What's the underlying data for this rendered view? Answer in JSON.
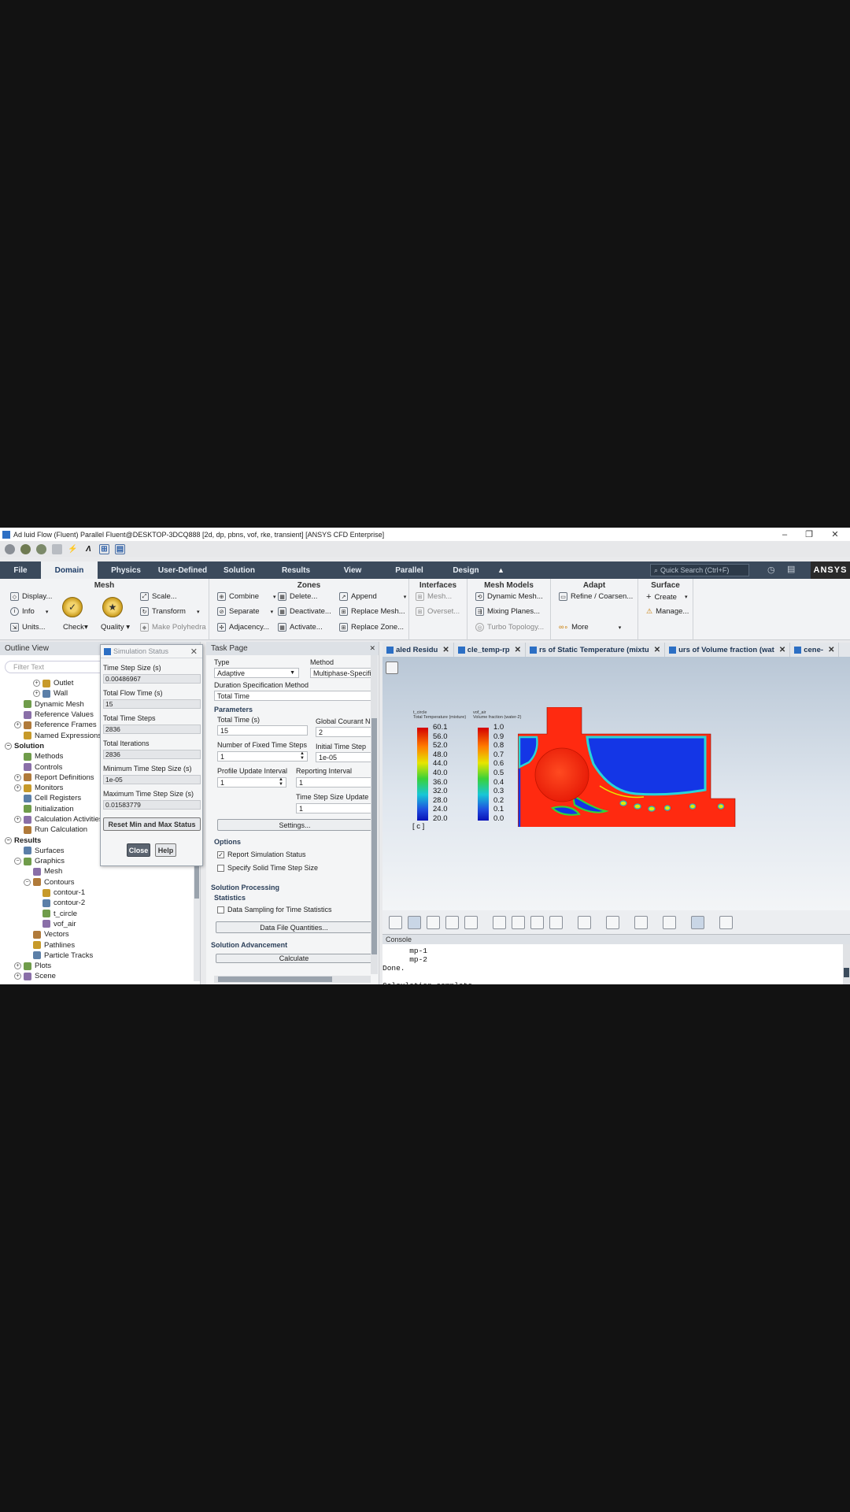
{
  "window": {
    "title": "Ad luid Flow (Fluent) Parallel Fluent@DESKTOP-3DCQ888  [2d, dp, pbns, vof, rke, transient] [ANSYS CFD Enterprise]",
    "minimize": "–",
    "restore": "❐",
    "close": "✕"
  },
  "ribbon_tabs": [
    "File",
    "Domain",
    "Physics",
    "User-Defined",
    "Solution",
    "Results",
    "View",
    "Parallel",
    "Design"
  ],
  "quick_search": {
    "placeholder": "Quick Search (Ctrl+F)"
  },
  "brand": "ANSYS",
  "ribbon": {
    "mesh": {
      "title": "Mesh",
      "display": "Display...",
      "info": "Info",
      "units": "Units...",
      "check": "Check",
      "quality": "Quality",
      "scale": "Scale...",
      "transform": "Transform",
      "polyhedra": "Make Polyhedra"
    },
    "zones": {
      "title": "Zones",
      "combine": "Combine",
      "separate": "Separate",
      "adjacency": "Adjacency...",
      "delete": "Delete...",
      "deactivate": "Deactivate...",
      "activate": "Activate...",
      "append": "Append",
      "replace_mesh": "Replace Mesh...",
      "replace_zone": "Replace Zone..."
    },
    "interfaces": {
      "title": "Interfaces",
      "mesh": "Mesh...",
      "overset": "Overset..."
    },
    "mesh_models": {
      "title": "Mesh Models",
      "dynamic": "Dynamic Mesh...",
      "mixing": "Mixing Planes...",
      "turbo": "Turbo Topology..."
    },
    "adapt": {
      "title": "Adapt",
      "refine": "Refine / Coarsen...",
      "more": "More"
    },
    "surface": {
      "title": "Surface",
      "create": "Create",
      "manage": "Manage..."
    }
  },
  "outline": {
    "title": "Outline View",
    "filter_placeholder": "Filter Text",
    "items": [
      {
        "label": "Outlet",
        "indent": 3,
        "exp": "+"
      },
      {
        "label": "Wall",
        "indent": 3,
        "exp": "+"
      },
      {
        "label": "Dynamic Mesh",
        "indent": 2
      },
      {
        "label": "Reference Values",
        "indent": 2
      },
      {
        "label": "Reference Frames",
        "indent": 1,
        "exp": "+"
      },
      {
        "label": "Named Expressions",
        "indent": 2
      },
      {
        "label": "Solution",
        "indent": 0,
        "exp": "−",
        "bold": true
      },
      {
        "label": "Methods",
        "indent": 2
      },
      {
        "label": "Controls",
        "indent": 2
      },
      {
        "label": "Report Definitions",
        "indent": 1,
        "exp": "+"
      },
      {
        "label": "Monitors",
        "indent": 1,
        "exp": "+"
      },
      {
        "label": "Cell Registers",
        "indent": 2
      },
      {
        "label": "Initialization",
        "indent": 2
      },
      {
        "label": "Calculation Activities",
        "indent": 1,
        "exp": "+"
      },
      {
        "label": "Run Calculation",
        "indent": 2
      },
      {
        "label": "Results",
        "indent": 0,
        "exp": "−",
        "bold": true
      },
      {
        "label": "Surfaces",
        "indent": 2
      },
      {
        "label": "Graphics",
        "indent": 1,
        "exp": "−"
      },
      {
        "label": "Mesh",
        "indent": 3
      },
      {
        "label": "Contours",
        "indent": 2,
        "exp": "−"
      },
      {
        "label": "contour-1",
        "indent": 4
      },
      {
        "label": "contour-2",
        "indent": 4
      },
      {
        "label": "t_circle",
        "indent": 4
      },
      {
        "label": "vof_air",
        "indent": 4
      },
      {
        "label": "Vectors",
        "indent": 3
      },
      {
        "label": "Pathlines",
        "indent": 3
      },
      {
        "label": "Particle Tracks",
        "indent": 3
      },
      {
        "label": "Plots",
        "indent": 1,
        "exp": "+"
      },
      {
        "label": "Scene",
        "indent": 1,
        "exp": "+"
      }
    ]
  },
  "sim_status": {
    "title": "Simulation Status",
    "close_x": "✕",
    "fields": [
      {
        "label": "Time Step Size (s)",
        "value": "0.00486967"
      },
      {
        "label": "Total Flow Time (s)",
        "value": "15"
      },
      {
        "label": "Total Time Steps",
        "value": "2836"
      },
      {
        "label": "Total Iterations",
        "value": "2836"
      },
      {
        "label": "Minimum Time Step Size (s)",
        "value": "1e-05"
      },
      {
        "label": "Maximum Time Step Size (s)",
        "value": "0.01583779"
      }
    ],
    "reset_button": "Reset Min and Max Status",
    "close_button": "Close",
    "help_button": "Help"
  },
  "task_page": {
    "title": "Task Page",
    "close_x": "✕",
    "type_label": "Type",
    "type_value": "Adaptive",
    "method_label": "Method",
    "method_value": "Multiphase-Specific",
    "duration_label": "Duration Specification Method",
    "duration_value": "Total Time",
    "parameters": "Parameters",
    "total_time_label": "Total Time (s)",
    "total_time_value": "15",
    "courant_label": "Global Courant Nu",
    "courant_value": "2",
    "fixed_steps_label": "Number of Fixed Time Steps",
    "fixed_steps_value": "1",
    "initial_step_label": "Initial Time Step",
    "initial_step_value": "1e-05",
    "profile_label": "Profile Update Interval",
    "profile_value": "1",
    "reporting_label": "Reporting Interval",
    "reporting_value": "1",
    "ts_update_label": "Time Step Size Update",
    "ts_update_value": "1",
    "settings_button": "Settings...",
    "options": "Options",
    "report_status": "Report Simulation Status",
    "solid_step": "Specify Solid Time Step Size",
    "processing": "Solution Processing",
    "statistics": "Statistics",
    "data_sampling": "Data Sampling for Time Statistics",
    "file_quantities": "Data File Quantities...",
    "advancement": "Solution Advancement",
    "calculate": "Calculate"
  },
  "graphics_tabs": [
    {
      "label": "aled Residu"
    },
    {
      "label": "cle_temp-rp"
    },
    {
      "label": "rs of Static Temperature (mixtu"
    },
    {
      "label": "urs of Volume fraction (wat"
    },
    {
      "label": "cene-"
    }
  ],
  "legend_temp": {
    "title1": "t_circle",
    "title2": "Total Temperature (mixture)",
    "ticks": [
      "60.1",
      "56.0",
      "52.0",
      "48.0",
      "44.0",
      "40.0",
      "36.0",
      "32.0",
      "28.0",
      "24.0",
      "20.0"
    ],
    "unit": "[ c ]"
  },
  "legend_vof": {
    "title1": "vof_air",
    "title2": "Volume fraction (water-2)",
    "ticks": [
      "1.0",
      "0.9",
      "0.8",
      "0.7",
      "0.6",
      "0.5",
      "0.4",
      "0.3",
      "0.2",
      "0.1",
      "0.0"
    ]
  },
  "console": {
    "title": "Console",
    "text": "      mp-1\n      mp-2\nDone.\n\nCalculation complete."
  },
  "colors": {
    "tab_bar": "#3b4a5c",
    "accent": "#2c6fc4",
    "field_red": "#ff2a10",
    "field_blue": "#1436e6"
  }
}
